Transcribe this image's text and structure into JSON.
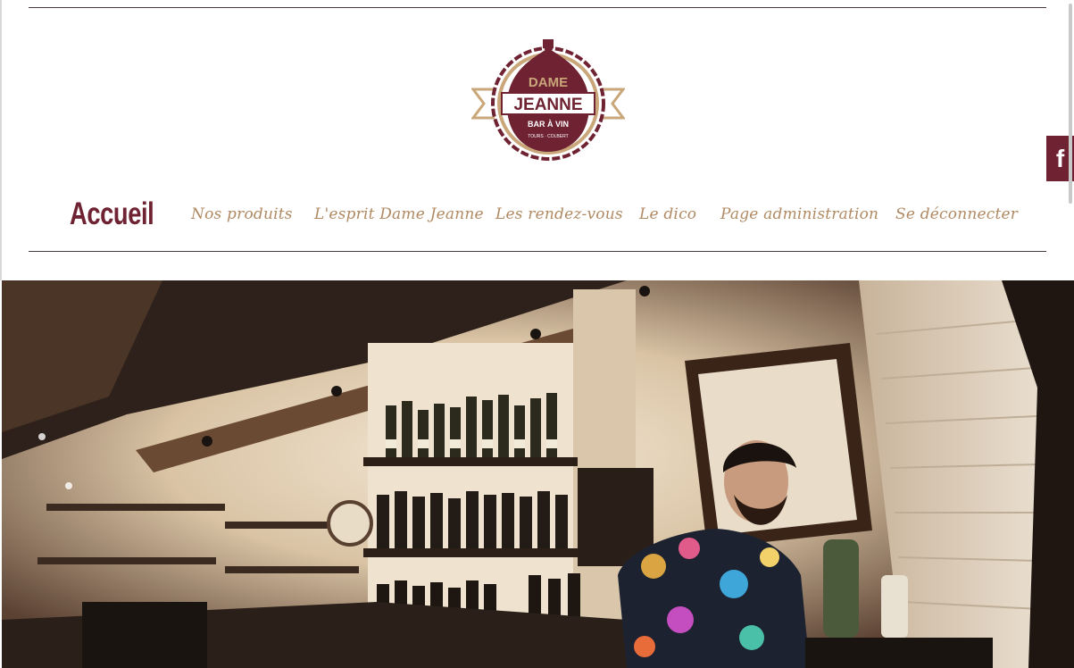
{
  "brand": {
    "logo_line1": "DAME",
    "logo_line2": "JEANNE",
    "logo_line3": "BAR À VIN",
    "logo_line4": "TOURS · COLBERT",
    "color_primary": "#6e2232",
    "color_accent": "#c9a77a"
  },
  "nav": {
    "items": [
      {
        "label": "Accueil",
        "active": true
      },
      {
        "label": "Nos produits",
        "active": false
      },
      {
        "label": "L'esprit Dame Jeanne",
        "active": false
      },
      {
        "label": "Les rendez-vous",
        "active": false
      },
      {
        "label": "Le dico",
        "active": false
      },
      {
        "label": "Page administration",
        "active": false
      },
      {
        "label": "Se déconnecter",
        "active": false
      }
    ]
  },
  "social": {
    "facebook_glyph": "f",
    "icon": "facebook-icon"
  },
  "hero": {
    "image": "wine-bar-interior-photo"
  }
}
